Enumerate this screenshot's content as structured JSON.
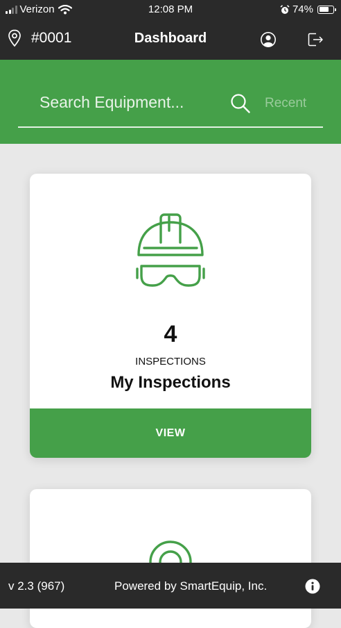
{
  "status_bar": {
    "carrier": "Verizon",
    "time": "12:08 PM",
    "battery": "74%",
    "battery_level": 0.74
  },
  "nav": {
    "location": "#0001",
    "title": "Dashboard"
  },
  "search": {
    "placeholder": "Search Equipment...",
    "recent_label": "Recent"
  },
  "cards": [
    {
      "count": "4",
      "unit": "INSPECTIONS",
      "title": "My Inspections",
      "action": "VIEW"
    }
  ],
  "footer": {
    "version": "v 2.3 (967)",
    "powered_by": "Powered by SmartEquip, Inc."
  },
  "colors": {
    "brand_green": "#45a049",
    "dark_bar": "#2a2a2a",
    "background": "#e8e8e8"
  },
  "icons": {
    "location": "map-pin-icon",
    "user": "user-icon",
    "logout": "logout-icon",
    "search": "search-icon",
    "card1": "hard-hat-goggles-icon",
    "card2": "target-icon",
    "info": "info-icon"
  }
}
